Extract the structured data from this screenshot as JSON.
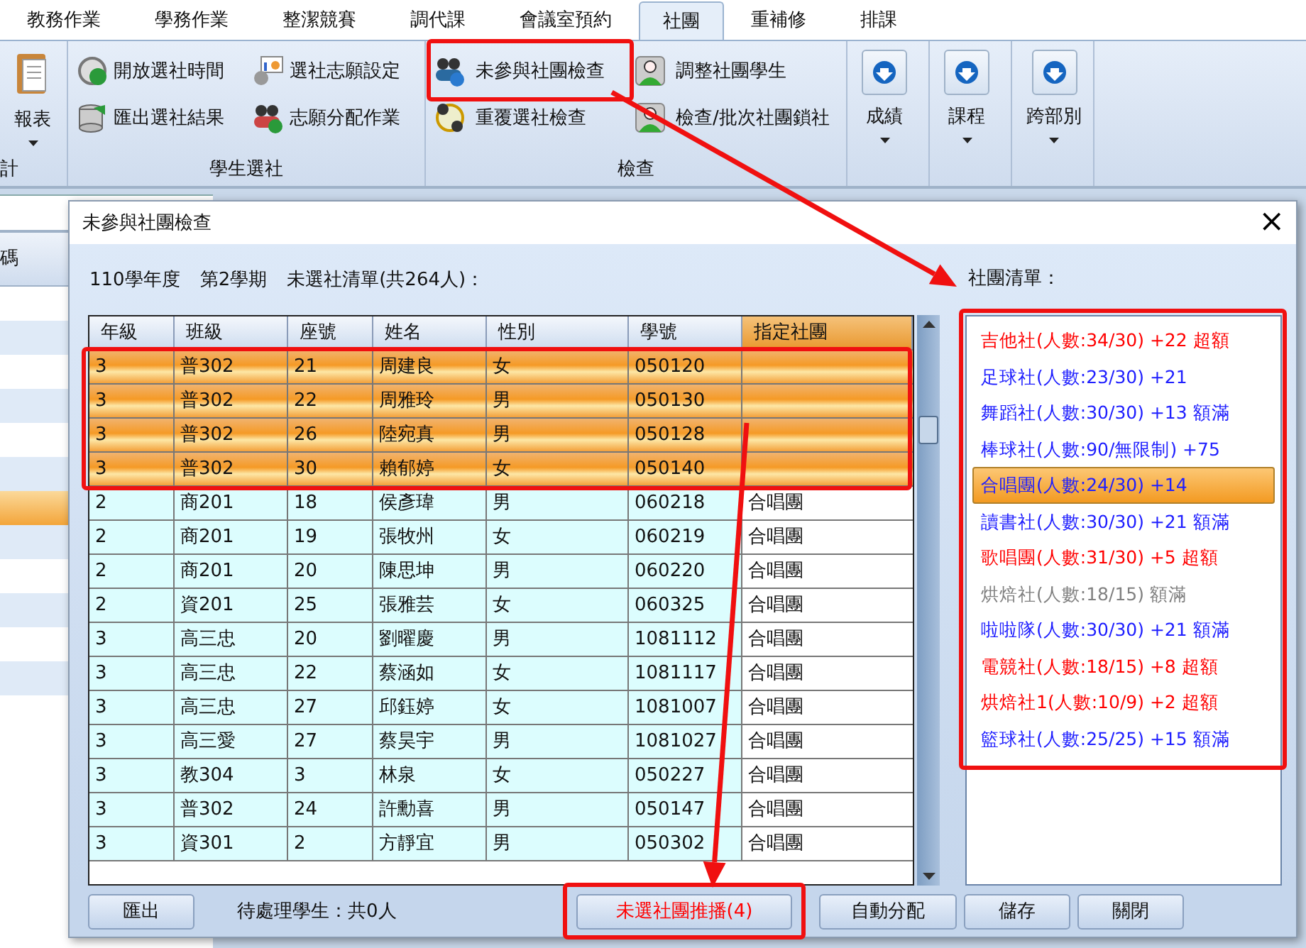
{
  "ribbon_tabs": [
    {
      "label": "教務作業",
      "selected": false
    },
    {
      "label": "學務作業",
      "selected": false
    },
    {
      "label": "整潔競賽",
      "selected": false
    },
    {
      "label": "調代課",
      "selected": false
    },
    {
      "label": "會議室預約",
      "selected": false
    },
    {
      "label": "社團",
      "selected": true
    },
    {
      "label": "重補修",
      "selected": false
    },
    {
      "label": "排課",
      "selected": false
    }
  ],
  "ribbon_groups": [
    {
      "kind": "large",
      "label": "計",
      "buttons": [
        {
          "label": "報表",
          "dropdown": true
        }
      ]
    },
    {
      "kind": "small",
      "label": "學生選社",
      "buttons": [
        {
          "label": "開放選社時間"
        },
        {
          "label": "匯出選社結果"
        },
        {
          "label": "選社志願設定"
        },
        {
          "label": "志願分配作業"
        }
      ]
    },
    {
      "kind": "small",
      "label": "檢查",
      "buttons": [
        {
          "label": "未參與社團檢查"
        },
        {
          "label": "重覆選社檢查"
        },
        {
          "label": "調整社團學生"
        },
        {
          "label": "檢查/批次社團鎖社"
        }
      ]
    },
    {
      "kind": "large",
      "buttons": [
        {
          "label": "成績",
          "dropdown": true
        }
      ]
    },
    {
      "kind": "large",
      "buttons": [
        {
          "label": "課程",
          "dropdown": true
        }
      ]
    },
    {
      "kind": "large",
      "buttons": [
        {
          "label": "跨部別",
          "dropdown": true
        }
      ]
    }
  ],
  "background_window": {
    "column_header": "碼"
  },
  "dialog": {
    "title": "未參與社團檢查",
    "close": "×",
    "info": [
      "110學年度",
      "第2學期",
      "未選社清單(共264人)："
    ],
    "club_list_label": "社團清單：",
    "table": {
      "columns": [
        "年級",
        "班級",
        "座號",
        "姓名",
        "性別",
        "學號",
        "指定社團"
      ],
      "rows": [
        {
          "cells": [
            "3",
            "普302",
            "21",
            "周建良",
            "女",
            "050120",
            ""
          ],
          "selected": true
        },
        {
          "cells": [
            "3",
            "普302",
            "22",
            "周雅玲",
            "男",
            "050130",
            ""
          ],
          "selected": true
        },
        {
          "cells": [
            "3",
            "普302",
            "26",
            "陸宛真",
            "男",
            "050128",
            ""
          ],
          "selected": true
        },
        {
          "cells": [
            "3",
            "普302",
            "30",
            "賴郁婷",
            "女",
            "050140",
            ""
          ],
          "selected": true
        },
        {
          "cells": [
            "2",
            "商201",
            "18",
            "侯彥瑋",
            "男",
            "060218",
            "合唱團"
          ],
          "selected": false
        },
        {
          "cells": [
            "2",
            "商201",
            "19",
            "張牧州",
            "女",
            "060219",
            "合唱團"
          ],
          "selected": false
        },
        {
          "cells": [
            "2",
            "商201",
            "20",
            "陳思坤",
            "男",
            "060220",
            "合唱團"
          ],
          "selected": false
        },
        {
          "cells": [
            "2",
            "資201",
            "25",
            "張雅芸",
            "女",
            "060325",
            "合唱團"
          ],
          "selected": false
        },
        {
          "cells": [
            "3",
            "高三忠",
            "20",
            "劉曜慶",
            "男",
            "1081112",
            "合唱團"
          ],
          "selected": false
        },
        {
          "cells": [
            "3",
            "高三忠",
            "22",
            "蔡涵如",
            "女",
            "1081117",
            "合唱團"
          ],
          "selected": false
        },
        {
          "cells": [
            "3",
            "高三忠",
            "27",
            "邱鈺婷",
            "女",
            "1081007",
            "合唱團"
          ],
          "selected": false
        },
        {
          "cells": [
            "3",
            "高三愛",
            "27",
            "蔡昊宇",
            "男",
            "1081027",
            "合唱團"
          ],
          "selected": false
        },
        {
          "cells": [
            "3",
            "教304",
            "3",
            "林泉",
            "女",
            "050227",
            "合唱團"
          ],
          "selected": false
        },
        {
          "cells": [
            "3",
            "普302",
            "24",
            "許勳喜",
            "男",
            "050147",
            "合唱團"
          ],
          "selected": false
        },
        {
          "cells": [
            "3",
            "資301",
            "2",
            "方靜宜",
            "男",
            "050302",
            "合唱團"
          ],
          "selected": false
        }
      ]
    },
    "clubs": [
      {
        "label": "吉他社(人數:34/30) +22 超額",
        "color": "#ff0000",
        "selected": false
      },
      {
        "label": "足球社(人數:23/30) +21",
        "color": "#2020ff",
        "selected": false
      },
      {
        "label": "舞蹈社(人數:30/30) +13 額滿",
        "color": "#2020ff",
        "selected": false
      },
      {
        "label": "棒球社(人數:90/無限制) +75",
        "color": "#2020ff",
        "selected": false
      },
      {
        "label": "合唱團(人數:24/30) +14",
        "color": "#2020ff",
        "selected": true
      },
      {
        "label": "讀書社(人數:30/30) +21 額滿",
        "color": "#2020ff",
        "selected": false
      },
      {
        "label": "歌唱團(人數:31/30) +5 超額",
        "color": "#ff0000",
        "selected": false
      },
      {
        "label": "烘焙社(人數:18/15) 額滿",
        "color": "#808080",
        "selected": false
      },
      {
        "label": "啦啦隊(人數:30/30) +21 額滿",
        "color": "#2020ff",
        "selected": false
      },
      {
        "label": "電競社(人數:18/15) +8 超額",
        "color": "#ff0000",
        "selected": false
      },
      {
        "label": "烘焙社1(人數:10/9) +2 超額",
        "color": "#ff0000",
        "selected": false
      },
      {
        "label": "籃球社(人數:25/25) +15 額滿",
        "color": "#2020ff",
        "selected": false
      }
    ],
    "footer": {
      "export_button": "匯出",
      "pending": "待處理學生：共0人",
      "buttons": [
        {
          "label": "未選社團推播(4)",
          "alert": true
        },
        {
          "label": "自動分配",
          "alert": false
        }
      ],
      "save_button": "儲存",
      "close_button": "關閉"
    }
  }
}
